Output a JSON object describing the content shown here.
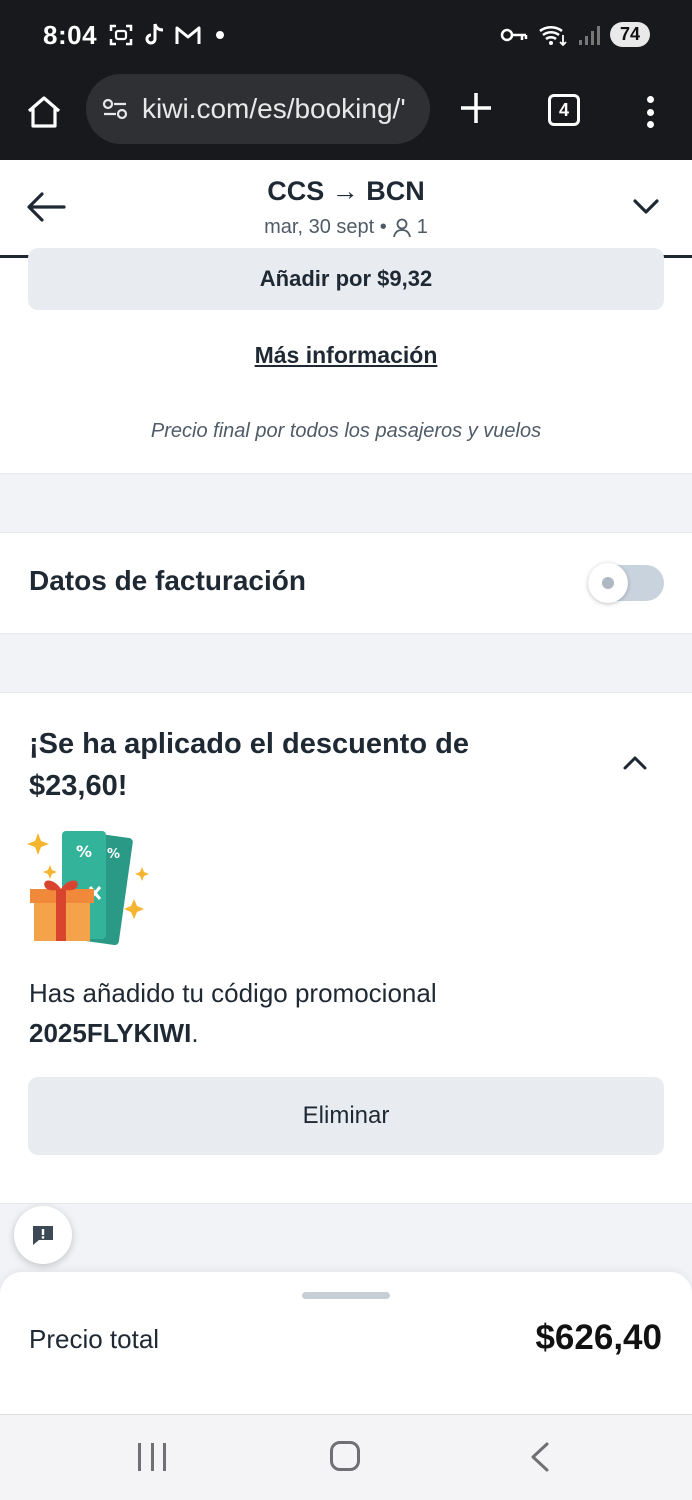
{
  "status_bar": {
    "time": "8:04",
    "battery": "74",
    "icons": [
      "screenshot-icon",
      "tiktok-icon",
      "gmail-icon",
      "notification-dot",
      "key-icon",
      "wifi-icon",
      "signal-icon"
    ]
  },
  "browser": {
    "url": "kiwi.com/es/booking/'",
    "tab_count": "4"
  },
  "header": {
    "route": "CCS → BCN",
    "date": "mar, 30 sept •",
    "passengers": "1"
  },
  "addon": {
    "add_label": "Añadir por $9,32",
    "more_info": "Más información",
    "final_price_note": "Precio final por todos los pasajeros y vuelos"
  },
  "billing": {
    "label": "Datos de facturación",
    "toggle_on": false
  },
  "discount": {
    "title": "¡Se ha aplicado el descuento de $23,60!",
    "promo_text": "Has añadido tu código promocional",
    "promo_code": "2025FLYKIWI",
    "remove_label": "Eliminar"
  },
  "footer": {
    "total_label": "Precio total",
    "total_value": "$626,40"
  },
  "colors": {
    "accent_teal": "#2bb39a",
    "text_dark": "#1f2933",
    "button_bg": "#e8ebf0",
    "status_bg": "#18191c"
  }
}
